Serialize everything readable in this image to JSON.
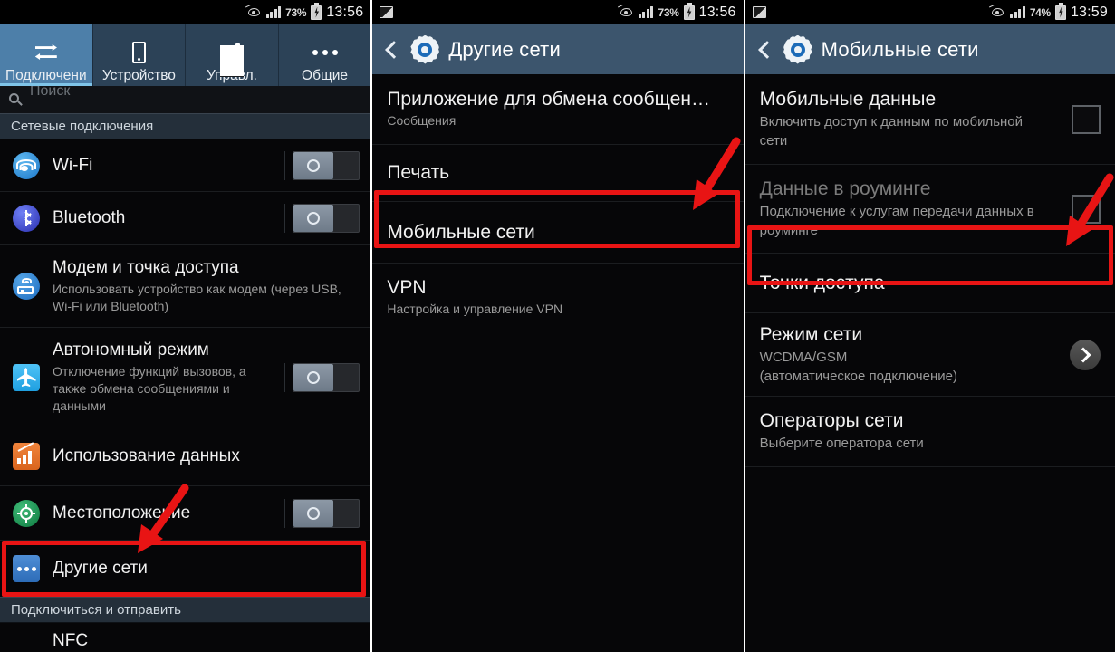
{
  "screens": [
    {
      "id": "connections",
      "statusbar": {
        "battery_percent": "73%",
        "time": "13:56",
        "icons": [
          "eye-icon",
          "signal-icon",
          "battery-charging-icon"
        ]
      },
      "tabs": [
        {
          "label": "Подключени",
          "icon": "connections-arrows-icon",
          "active": true
        },
        {
          "label": "Устройство",
          "icon": "phone-icon",
          "active": false
        },
        {
          "label": "Управл.",
          "icon": "sliders-icon",
          "active": false
        },
        {
          "label": "Общие",
          "icon": "more-dots-icon",
          "active": false
        }
      ],
      "search": {
        "placeholder": "Поиск"
      },
      "sections": [
        {
          "header": "Сетевые подключения",
          "items": [
            {
              "title": "Wi-Fi",
              "sub": "",
              "icon": "wifi-icon",
              "control": "toggle",
              "toggle_state": "off"
            },
            {
              "title": "Bluetooth",
              "sub": "",
              "icon": "bluetooth-icon",
              "control": "toggle",
              "toggle_state": "off"
            },
            {
              "title": "Модем и точка доступа",
              "sub": "Использовать устройство как модем (через USB, Wi-Fi или Bluetooth)",
              "icon": "tethering-icon",
              "control": "none"
            },
            {
              "title": "Автономный режим",
              "sub": "Отключение функций вызовов, а также обмена сообщениями и данными",
              "icon": "airplane-icon",
              "control": "toggle",
              "toggle_state": "off"
            },
            {
              "title": "Использование данных",
              "sub": "",
              "icon": "data-usage-icon",
              "control": "none"
            },
            {
              "title": "Местоположение",
              "sub": "",
              "icon": "location-icon",
              "control": "toggle",
              "toggle_state": "off"
            },
            {
              "title": "Другие сети",
              "sub": "",
              "icon": "other-networks-icon",
              "control": "none",
              "highlighted": true
            }
          ]
        },
        {
          "header": "Подключиться и отправить",
          "items": [
            {
              "title": "NFC",
              "sub": "",
              "icon": "none",
              "control": "none"
            }
          ]
        }
      ]
    },
    {
      "id": "other-networks",
      "statusbar": {
        "battery_percent": "73%",
        "time": "13:56",
        "icons": [
          "screenshot-icon",
          "eye-icon",
          "signal-icon",
          "battery-charging-icon"
        ]
      },
      "header": {
        "title": "Другие сети",
        "back": "back-chevron-icon",
        "icon": "gear-icon"
      },
      "items": [
        {
          "title": "Приложение для обмена сообщен…",
          "sub": "Сообщения",
          "control": "none"
        },
        {
          "title": "Печать",
          "sub": "",
          "control": "none"
        },
        {
          "title": "Мобильные сети",
          "sub": "",
          "control": "none",
          "highlighted": true
        },
        {
          "title": "VPN",
          "sub": "Настройка и управление VPN",
          "control": "none"
        }
      ]
    },
    {
      "id": "mobile-networks",
      "statusbar": {
        "battery_percent": "74%",
        "time": "13:59",
        "icons": [
          "screenshot-icon",
          "eye-icon",
          "signal-icon",
          "battery-charging-icon"
        ]
      },
      "header": {
        "title": "Мобильные сети",
        "back": "back-chevron-icon",
        "icon": "gear-icon"
      },
      "items": [
        {
          "title": "Мобильные данные",
          "sub": "Включить доступ к данным по мобильной сети",
          "control": "checkbox",
          "checked": false,
          "disabled": false
        },
        {
          "title": "Данные в роуминге",
          "sub": "Подключение к услугам передачи данных в роуминге",
          "control": "checkbox",
          "checked": false,
          "disabled": true
        },
        {
          "title": "Точки доступа",
          "sub": "",
          "control": "none",
          "highlighted": true
        },
        {
          "title": "Режим сети",
          "sub": "WCDMA/GSM\n(автоматическое подключение)",
          "control": "chevron"
        },
        {
          "title": "Операторы сети",
          "sub": "Выберите оператора сети",
          "control": "none"
        }
      ]
    }
  ],
  "annotations": {
    "highlight_color": "#e81414",
    "arrow_color": "#e81414",
    "arrows": [
      {
        "screen": "connections",
        "points_to": "Другие сети"
      },
      {
        "screen": "other-networks",
        "points_to": "Мобильные сети"
      },
      {
        "screen": "mobile-networks",
        "points_to": "Точки доступа"
      }
    ]
  }
}
